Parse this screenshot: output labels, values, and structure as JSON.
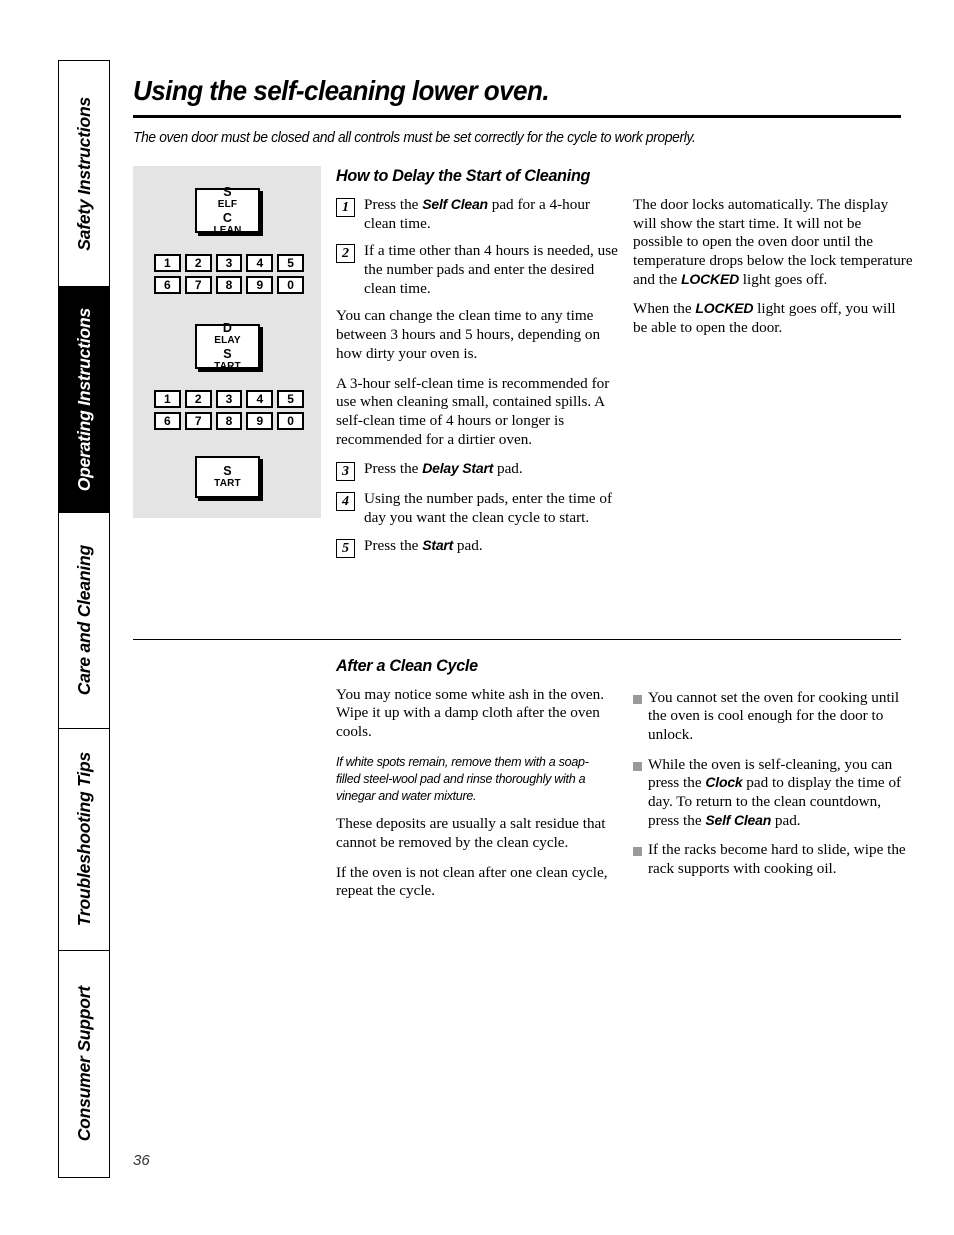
{
  "sidebar": {
    "tabs": [
      {
        "label": "Safety Instructions",
        "active": false
      },
      {
        "label": "Operating Instructions",
        "active": true
      },
      {
        "label": "Care and Cleaning",
        "active": false
      },
      {
        "label": "Troubleshooting Tips",
        "active": false
      },
      {
        "label": "Consumer Support",
        "active": false
      }
    ]
  },
  "header": {
    "title": "Using the self-cleaning lower oven.",
    "intro": "The oven door must be closed and all controls must be set correctly for the cycle to work properly."
  },
  "control_panel": {
    "pads": {
      "self_clean_line1": "Self",
      "self_clean_line2": "Clean",
      "delay_start_line1": "Delay",
      "delay_start_line2": "Start",
      "start": "Start"
    },
    "keypad_row1": [
      "1",
      "2",
      "3",
      "4",
      "5"
    ],
    "keypad_row2": [
      "6",
      "7",
      "8",
      "9",
      "0"
    ]
  },
  "section_delay": {
    "heading": "How to Delay the Start of Cleaning",
    "steps": [
      {
        "num": "1",
        "pre": "Press the ",
        "emph": "Self Clean",
        "post": " pad for a 4-hour clean time."
      },
      {
        "num": "2",
        "pre": "If a time other than 4 hours is needed, use the number pads and enter the desired clean time.",
        "emph": "",
        "post": ""
      },
      {
        "num": "3",
        "pre": "Press the ",
        "emph": "Delay Start",
        "post": " pad."
      },
      {
        "num": "4",
        "pre": "Using the number pads, enter the time of day you want the clean cycle to start.",
        "emph": "",
        "post": ""
      },
      {
        "num": "5",
        "pre": "Press the ",
        "emph": "Start",
        "post": " pad."
      }
    ],
    "para_after_step2_a": "You can change the clean time to any time between 3 hours and 5 hours, depending on how dirty your oven is.",
    "para_after_step2_b": "A 3-hour self-clean time is recommended for use when cleaning small, contained spills. A self-clean time of 4 hours or longer is recommended for a dirtier oven.",
    "right_para1_a": "The door locks automatically. The display will show the start time. It will not be possible to open the oven door until the temperature drops below the lock temperature and the ",
    "right_para1_emph": "LOCKED",
    "right_para1_b": " light goes off.",
    "right_para2_a": "When the ",
    "right_para2_emph": "LOCKED",
    "right_para2_b": " light goes off, you will be able to open the door."
  },
  "section_after": {
    "heading": "After a Clean Cycle",
    "para1": "You may notice some white ash in the oven. Wipe it up with a damp cloth after the oven cools.",
    "note": "If white spots remain, remove them with a soap-filled steel-wool pad and rinse thoroughly with a vinegar and water mixture.",
    "para2": "These deposits are usually a salt residue that cannot be removed by the clean cycle.",
    "para3": "If the oven is not clean after one clean cycle, repeat the cycle.",
    "bullets": [
      {
        "a": "You cannot set the oven for cooking until the oven is cool enough for the door to unlock.",
        "emph1": "",
        "b": "",
        "emph2": "",
        "c": ""
      },
      {
        "a": "While the oven is self-cleaning, you can press the ",
        "emph1": "Clock",
        "b": " pad to display the time of day. To return to the clean countdown, press the ",
        "emph2": "Self Clean",
        "c": " pad."
      },
      {
        "a": "If the racks become hard to slide, wipe the rack supports with cooking oil.",
        "emph1": "",
        "b": "",
        "emph2": "",
        "c": ""
      }
    ]
  },
  "footer": {
    "page_number": "36"
  }
}
